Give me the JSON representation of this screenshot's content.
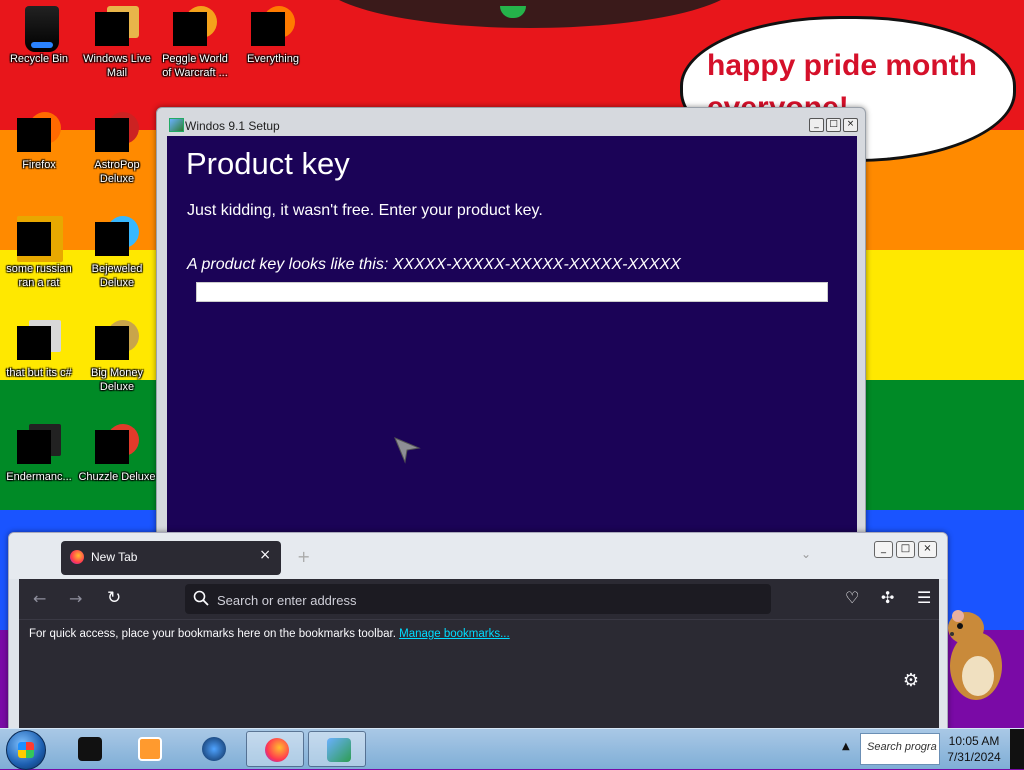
{
  "desktop": {
    "bubble_text": "happy pride month everyone!",
    "icons": [
      {
        "label": "Recycle Bin",
        "icon": "recycle-bin-icon"
      },
      {
        "label": "Windows Live Mail",
        "icon": "mail-icon"
      },
      {
        "label": "Peggle World of Warcraft ...",
        "icon": "peggle-icon"
      },
      {
        "label": "Everything",
        "icon": "search-app-icon"
      },
      {
        "label": "Firefox",
        "icon": "firefox-icon"
      },
      {
        "label": "AstroPop Deluxe",
        "icon": "astropop-icon"
      },
      {
        "label": "some russian ran a rat",
        "icon": "app-icon"
      },
      {
        "label": "Bejeweled Deluxe",
        "icon": "bejeweled-icon"
      },
      {
        "label": "that but its c#",
        "icon": "window-stack-icon"
      },
      {
        "label": "Big Money Deluxe",
        "icon": "money-bag-icon"
      },
      {
        "label": "Endermanc...",
        "icon": "terminal-icon"
      },
      {
        "label": "Chuzzle Deluxe",
        "icon": "chuzzle-icon"
      }
    ]
  },
  "setup_window": {
    "title": "Windos 9.1 Setup",
    "heading": "Product key",
    "description": "Just kidding, it wasn't free. Enter your product key.",
    "hint": "A product key looks like this: XXXXX-XXXXX-XXXXX-XXXXX-XXXXX",
    "input_value": ""
  },
  "browser": {
    "tab_label": "New Tab",
    "tab_close": "×",
    "new_tab": "+",
    "tab_list": "⌄",
    "url_placeholder": "Search or enter address",
    "bookmarks_text": "For quick access, place your bookmarks here on the bookmarks toolbar. ",
    "bookmarks_link": "Manage bookmarks...",
    "back": "←",
    "forward": "→",
    "reload": "↻",
    "pocket": "♡",
    "extensions": "✣",
    "menu": "☰",
    "settings": "⚙"
  },
  "window_controls": {
    "minimize": "_",
    "maximize": "□",
    "close": "×"
  },
  "taskbar": {
    "tray_search": "Search progra",
    "tray_expand": "▲",
    "time": "10:05 AM",
    "date": "7/31/2024",
    "items": [
      {
        "name": "taskbar-item-terminal",
        "active": false
      },
      {
        "name": "taskbar-item-media-player",
        "active": false
      },
      {
        "name": "taskbar-item-globe",
        "active": false
      },
      {
        "name": "taskbar-item-firefox",
        "active": true
      },
      {
        "name": "taskbar-item-setup",
        "active": true
      }
    ]
  },
  "colors": {
    "setup_bg": "#1b0357",
    "firefox_dark": "#2b2a33",
    "link": "#00ddff",
    "bubble_text": "#d5102a"
  }
}
